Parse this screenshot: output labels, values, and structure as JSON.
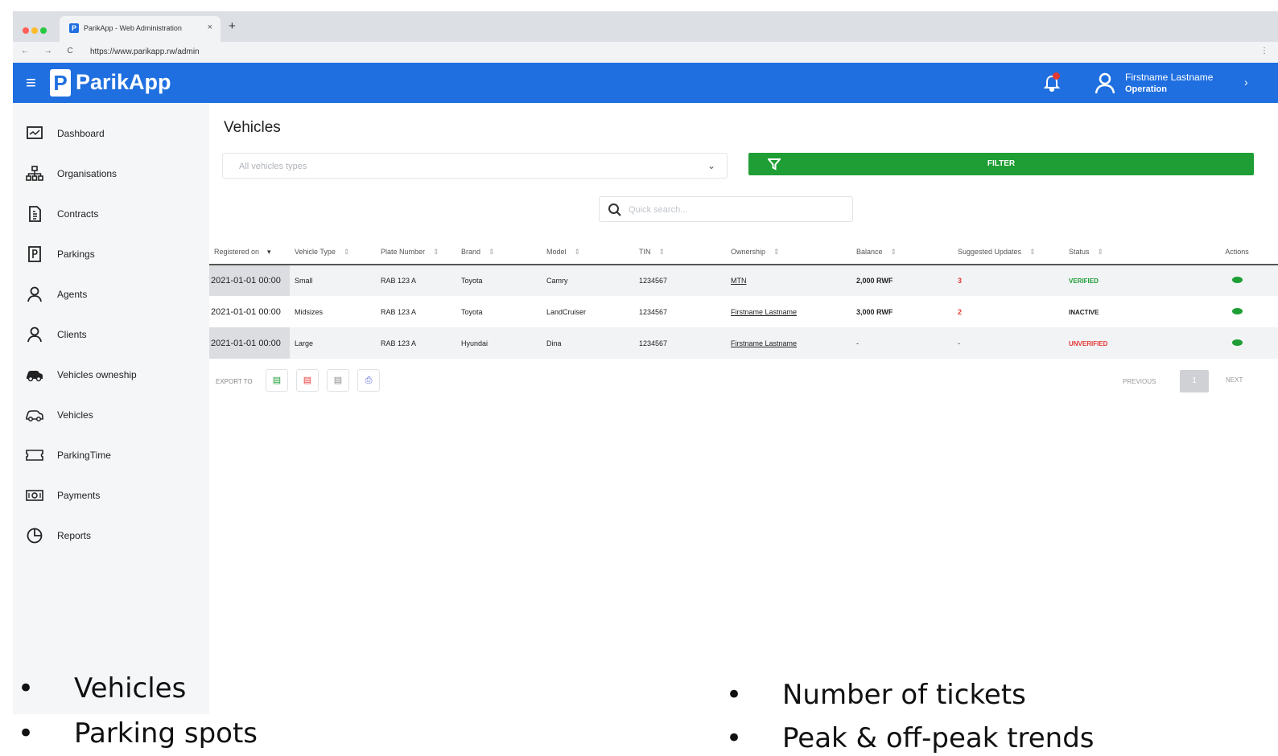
{
  "browser": {
    "tab_title": "ParikApp - Web Administration",
    "tab_close": "×",
    "new_tab": "+",
    "nav_controls": "← → C",
    "url": "https://www.parikapp.rw/admin",
    "menu": "⋮"
  },
  "header": {
    "menu_icon": "≡",
    "logo_letter": "P",
    "brand": "ParikApp",
    "user_name": "Firstname Lastname",
    "user_role": "Operation",
    "chevron": "›",
    "accent_color": "#1f6fe0"
  },
  "sidebar": {
    "items": [
      {
        "label": "Dashboard",
        "icon": "dashboard-icon"
      },
      {
        "label": "Organisations",
        "icon": "org-chart-icon"
      },
      {
        "label": "Contracts",
        "icon": "contract-icon"
      },
      {
        "label": "Parkings",
        "icon": "parking-icon"
      },
      {
        "label": "Agents",
        "icon": "agent-icon"
      },
      {
        "label": "Clients",
        "icon": "client-icon"
      },
      {
        "label": "Vehicles owneship",
        "icon": "car-ownership-icon"
      },
      {
        "label": "Vehicles",
        "icon": "car-icon"
      },
      {
        "label": "ParkingTime",
        "icon": "ticket-icon"
      },
      {
        "label": "Payments",
        "icon": "payment-icon"
      },
      {
        "label": "Reports",
        "icon": "pie-chart-icon"
      }
    ]
  },
  "main": {
    "title": "Vehicles",
    "type_select_placeholder": "All vehicles types",
    "filter_label": "FILTER",
    "search_placeholder": "Quick search...",
    "table": {
      "columns": [
        "Registered on",
        "Vehicle Type",
        "Plate Number",
        "Brand",
        "Model",
        "TIN",
        "Ownership",
        "Balance",
        "Suggested Updates",
        "Status",
        "Actions"
      ],
      "rows": [
        {
          "registered_on": "2021-01-01 00:00",
          "vehicle_type": "Small",
          "plate": "RAB 123 A",
          "brand": "Toyota",
          "model": "Camry",
          "tin": "1234567",
          "ownership": "MTN",
          "balance": "2,000 RWF",
          "updates": "3",
          "status": "VERIFIED"
        },
        {
          "registered_on": "2021-01-01 00:00",
          "vehicle_type": "Midsizes",
          "plate": "RAB 123 A",
          "brand": "Toyota",
          "model": "LandCruiser",
          "tin": "1234567",
          "ownership": "Firstname Lastname",
          "balance": "3,000 RWF",
          "updates": "2",
          "status": "INACTIVE"
        },
        {
          "registered_on": "2021-01-01 00:00",
          "vehicle_type": "Large",
          "plate": "RAB 123 A",
          "brand": "Hyundai",
          "model": "Dina",
          "tin": "1234567",
          "ownership": "Firstname Lastname",
          "balance": "-",
          "updates": "-",
          "status": "UNVERIFIED"
        }
      ]
    },
    "export_label": "EXPORT TO",
    "pagination": {
      "previous": "PREVIOUS",
      "page": "1",
      "next": "NEXT"
    }
  },
  "notes": {
    "left": [
      "Vehicles",
      "Parking spots"
    ],
    "right": [
      "Number of tickets",
      "Peak & off-peak trends"
    ]
  },
  "colors": {
    "verified": "#1e9e34",
    "unverified": "#e53935",
    "filter_button": "#1e9e34"
  }
}
